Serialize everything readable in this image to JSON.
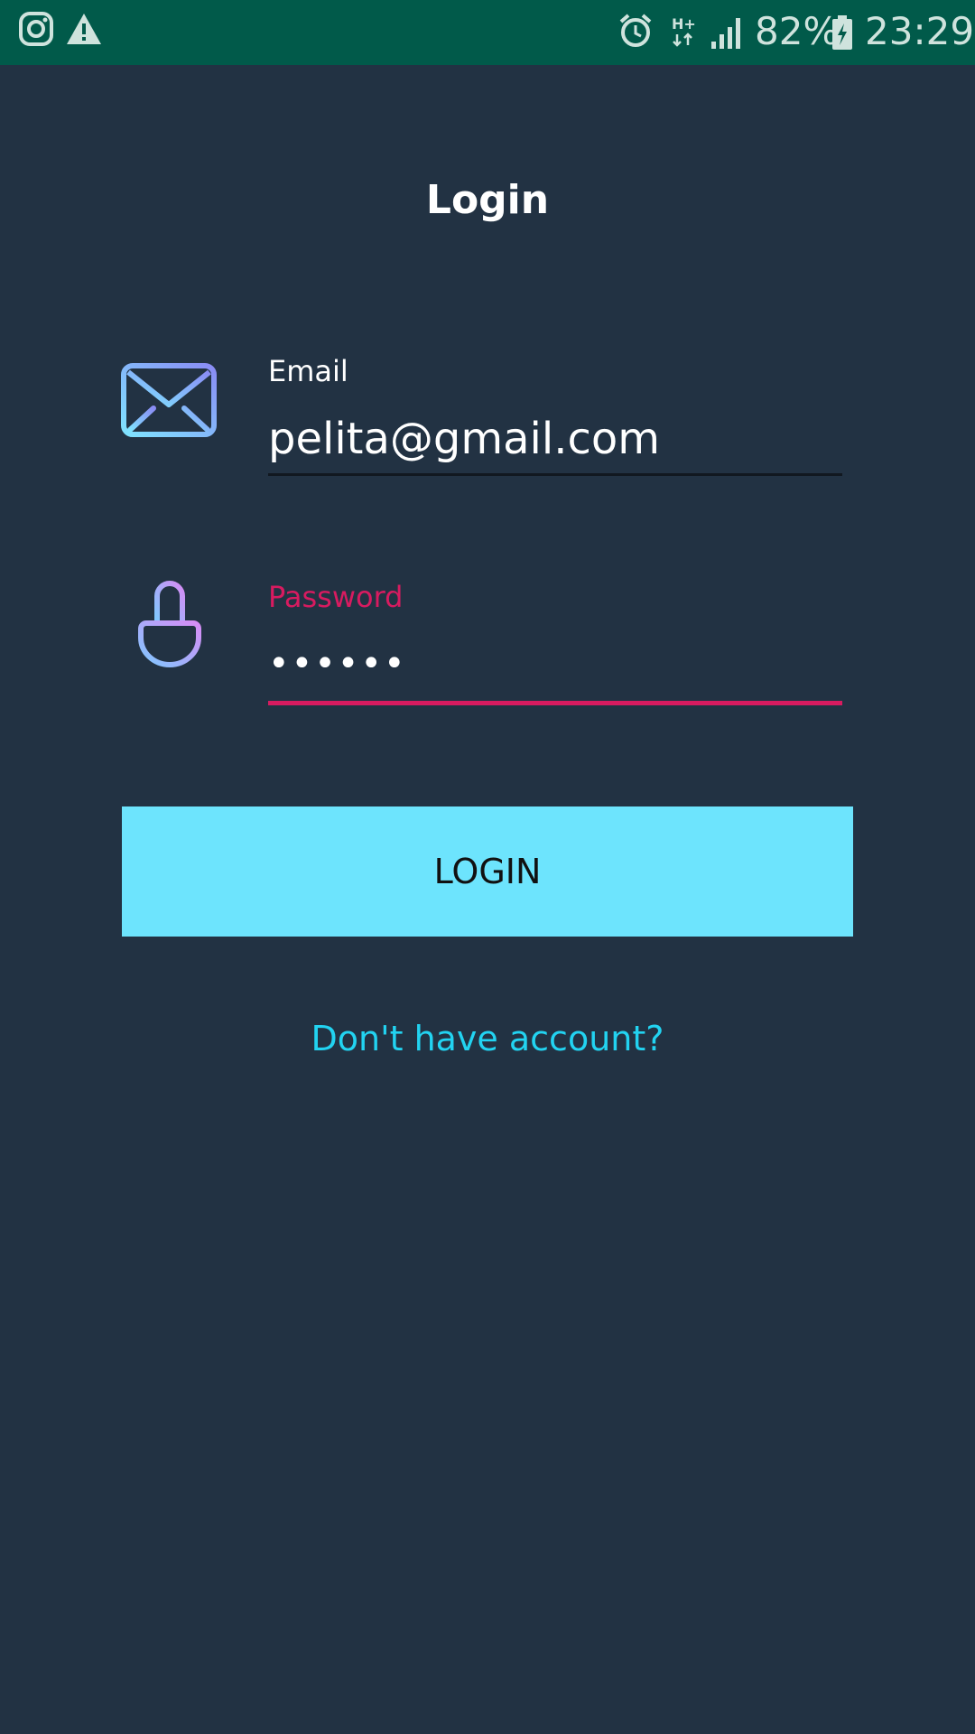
{
  "status_bar": {
    "battery_percent": "82%",
    "time": "23:29",
    "network_type": "H+",
    "icons": [
      "instagram-icon",
      "warning-icon",
      "alarm-icon",
      "network-type-icon",
      "signal-icon",
      "battery-charging-icon"
    ]
  },
  "page": {
    "title": "Login"
  },
  "email": {
    "label": "Email",
    "value": "pelita@gmail.com",
    "icon": "envelope-icon"
  },
  "password": {
    "label": "Password",
    "value": "••••••",
    "icon": "lock-icon"
  },
  "login_button": {
    "label": "LOGIN"
  },
  "signup_link": {
    "label": "Don't have account?"
  },
  "colors": {
    "background": "#223243",
    "status_bar": "#015a4a",
    "button": "#6de4fd",
    "link": "#22d3f1",
    "focus_accent": "#d81b60"
  }
}
